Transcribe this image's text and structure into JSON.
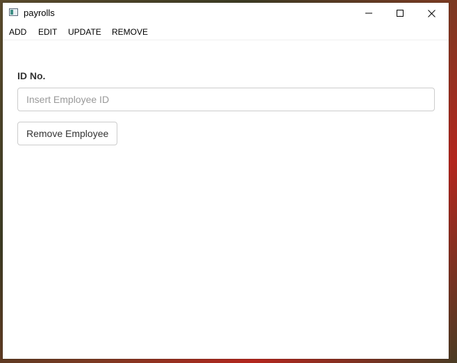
{
  "window": {
    "title": "payrolls",
    "icon": "app-window-icon"
  },
  "titlebar_controls": {
    "minimize_icon": "minimize-icon",
    "maximize_icon": "maximize-icon",
    "close_icon": "close-icon"
  },
  "menu": {
    "items": [
      {
        "label": "ADD"
      },
      {
        "label": "EDIT"
      },
      {
        "label": "UPDATE"
      },
      {
        "label": "REMOVE"
      }
    ]
  },
  "form": {
    "id_label": "ID No.",
    "id_input": {
      "value": "",
      "placeholder": "Insert Employee ID"
    },
    "submit_label": "Remove Employee"
  },
  "colors": {
    "label_text": "#333333",
    "input_border": "#cccccc",
    "placeholder": "#999999",
    "window_bg": "#ffffff"
  }
}
